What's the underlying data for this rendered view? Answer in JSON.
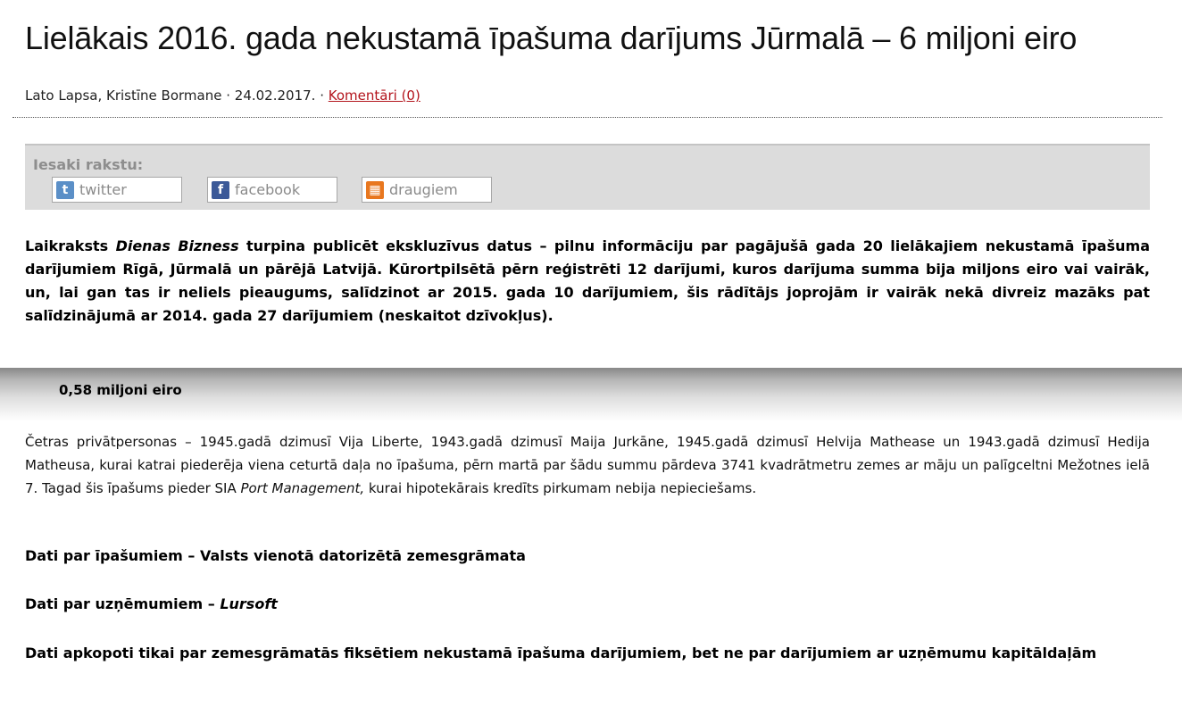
{
  "article": {
    "title": "Lielākais 2016. gada nekustamā īpašuma darījums Jūrmalā – 6 miljoni eiro",
    "authors": "Lato Lapsa, Kristīne Bormane",
    "separator": "·",
    "date": "24.02.2017.",
    "comments_link": "Komentāri (0)"
  },
  "share": {
    "label": "Iesaki rakstu:",
    "buttons": [
      {
        "label": "twitter",
        "icon": "twitter-icon",
        "color": "#5b8fc7"
      },
      {
        "label": "facebook",
        "icon": "facebook-icon",
        "color": "#3b5998"
      },
      {
        "label": "draugiem",
        "icon": "draugiem-icon",
        "color": "#e8771f"
      }
    ]
  },
  "lead": {
    "part1": "Laikraksts ",
    "publication": "Dienas Bizness",
    "part2": " turpina publicēt ekskluzīvus datus – pilnu informāciju par pagājušā gada 20 lielākajiem nekustamā īpašuma darījumiem Rīgā, Jūrmalā un pārējā Latvijā. Kūrortpilsētā pērn reģistrēti 12 darījumi, kuros darījuma summa bija miljons eiro vai vairāk, un, lai gan tas ir neliels pieaugums, salīdzinot ar 2015. gada 10 darījumiem, šis rādītājs joprojām ir vairāk nekā divreiz mazāks pat salīdzinājumā ar 2014. gada 27 darījumiem (neskaitot dzīvokļus)."
  },
  "section": {
    "subheading": "0,58 miljoni eiro",
    "text1": "Četras privātpersonas – 1945.gadā dzimusī Vija Liberte, 1943.gadā dzimusī Maija Jurkāne, 1945.gadā dzimusī Helvija Mathease un 1943.gadā dzimusī Hedija Matheusa, kurai katrai piederēja viena ceturtā daļa no īpašuma, pērn martā par šādu summu pārdeva 3741 kvadrātmetru zemes ar māju un palīgceltni Mežotnes ielā 7. Tagad šis īpašums pieder SIA ",
    "company": "Port Management,",
    "text2": " kurai hipotekārais kredīts pirkumam nebija nepieciešams."
  },
  "notes": {
    "properties": "Dati par īpašumiem – Valsts vienotā datorizētā zemesgrāmata",
    "companies_prefix": "Dati par uzņēmumiem – ",
    "companies_source": "Lursoft",
    "disclaimer": "Dati apkopoti tikai par zemesgrāmatās fiksētiem nekustamā īpašuma darījumiem, bet ne par darījumiem ar uzņēmumu kapitāldaļām"
  }
}
